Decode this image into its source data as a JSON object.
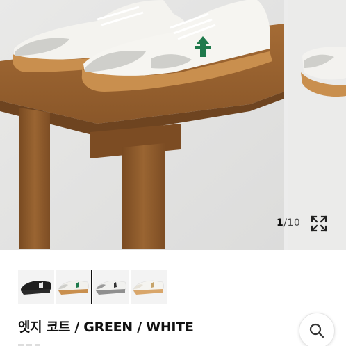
{
  "gallery": {
    "current_index": "1",
    "separator": "/",
    "total": "10"
  },
  "thumbnails": [
    {
      "name": "black-sneaker",
      "selected": false
    },
    {
      "name": "white-gum-sneaker",
      "selected": true
    },
    {
      "name": "grey-sneaker",
      "selected": false
    },
    {
      "name": "white-tan-sneaker",
      "selected": false
    }
  ],
  "product": {
    "title": "엣지 코트 / GREEN / WHITE"
  },
  "colors": {
    "background": "#ececec",
    "table_wood": "#8a5a2b",
    "gum_sole": "#c98f4e",
    "accent_green": "#1f7a4c"
  },
  "icons": {
    "expand": "expand-icon",
    "search": "search-icon"
  }
}
